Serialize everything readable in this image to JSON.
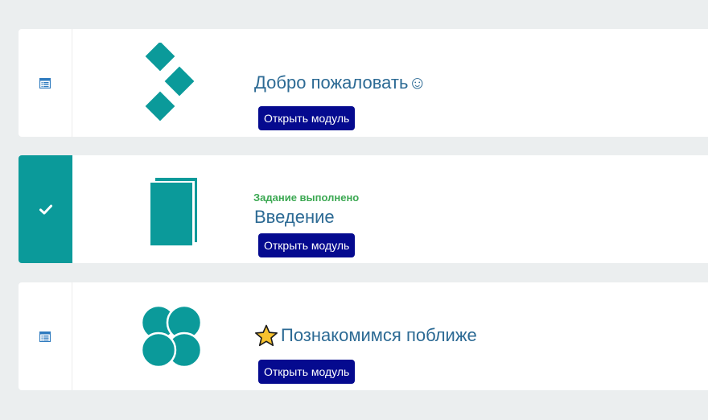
{
  "colors": {
    "page_bg": "#ebeeef",
    "teal": "#0b9a9a",
    "title": "#2c6a94",
    "button_bg": "#050a8f",
    "done_green": "#3ba852",
    "list_icon_blue": "#2f7bbf"
  },
  "modules": [
    {
      "status": "list-icon",
      "completed": false,
      "title": "Добро пожаловать☺",
      "button_label": "Открыть модуль",
      "thumbnail": "diamond-pattern"
    },
    {
      "status": "check-icon",
      "completed": true,
      "completed_label": "Задание выполнено",
      "title": "Введение",
      "button_label": "Открыть модуль",
      "thumbnail": "book-pages"
    },
    {
      "status": "list-icon",
      "completed": false,
      "title": "Познакомимся поближе",
      "title_prefix_icon": "star-icon",
      "button_label": "Открыть модуль",
      "thumbnail": "four-circles"
    }
  ]
}
